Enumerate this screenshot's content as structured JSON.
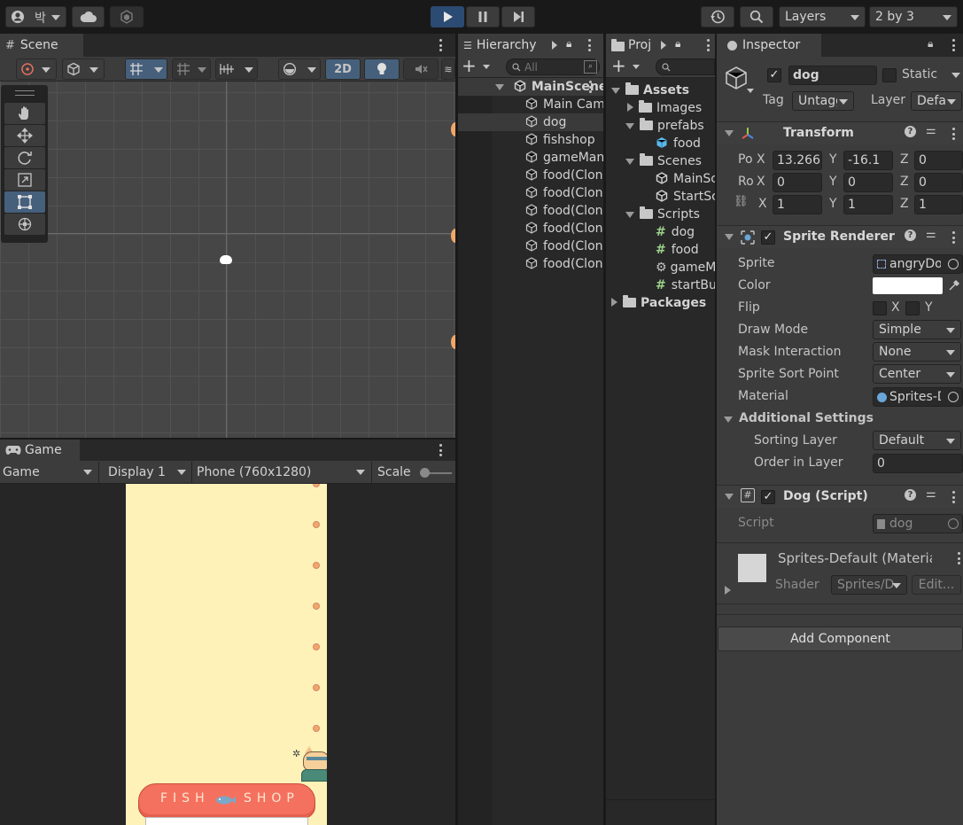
{
  "toolbar": {
    "account_label": "박",
    "layers_label": "Layers",
    "layout_label": "2 by 3"
  },
  "scene": {
    "tab_label": "Scene",
    "mode_2d_label": "2D"
  },
  "game": {
    "tab_label": "Game",
    "view_dropdown": "Game",
    "display_dropdown": "Display 1",
    "resolution_dropdown": "Phone (760x1280)",
    "scale_label": "Scale",
    "awning_text_left": "FISH",
    "awning_text_right": "SHOP"
  },
  "hierarchy": {
    "tab_label": "Hierarchy",
    "search_placeholder": "All",
    "root": "MainScene",
    "items": [
      "Main Camera",
      "dog",
      "fishshop",
      "gameManager",
      "food(Clone)",
      "food(Clone)",
      "food(Clone)",
      "food(Clone)",
      "food(Clone)",
      "food(Clone)"
    ]
  },
  "project": {
    "tab_label": "Project",
    "assets": "Assets",
    "images": "Images",
    "prefabs": "prefabs",
    "prefab_food": "food",
    "scenes": "Scenes",
    "scene_main": "MainScene",
    "scene_start": "StartScene",
    "scripts": "Scripts",
    "script_dog": "dog",
    "script_food": "food",
    "script_gm": "gameManager",
    "script_start": "startButton",
    "packages": "Packages"
  },
  "inspector": {
    "tab_label": "Inspector",
    "object_name": "dog",
    "static_label": "Static",
    "tag_label": "Tag",
    "tag_value": "Untagged",
    "layer_label": "Layer",
    "layer_value": "Default",
    "transform": {
      "title": "Transform",
      "pos_label": "Po",
      "rot_label": "Ro",
      "pos": {
        "x": "13.266",
        "y": "-16.1",
        "z": "0"
      },
      "rot": {
        "x": "0",
        "y": "0",
        "z": "0"
      },
      "scale": {
        "x": "1",
        "y": "1",
        "z": "1"
      },
      "x": "X",
      "y": "Y",
      "z": "Z"
    },
    "sprite_renderer": {
      "title": "Sprite Renderer",
      "sprite_label": "Sprite",
      "sprite_value": "angryDog",
      "color_label": "Color",
      "flip_label": "Flip",
      "flip_x": "X",
      "flip_y": "Y",
      "draw_mode_label": "Draw Mode",
      "draw_mode_value": "Simple",
      "mask_label": "Mask Interaction",
      "mask_value": "None",
      "sort_point_label": "Sprite Sort Point",
      "sort_point_value": "Center",
      "material_label": "Material",
      "material_value": "Sprites-Default",
      "additional_label": "Additional Settings",
      "sorting_layer_label": "Sorting Layer",
      "sorting_layer_value": "Default",
      "order_label": "Order in Layer",
      "order_value": "0"
    },
    "dog_script": {
      "title": "Dog (Script)",
      "script_label": "Script",
      "script_value": "dog"
    },
    "material": {
      "title": "Sprites-Default (Material)",
      "shader_label": "Shader",
      "shader_value": "Sprites/Default",
      "edit_label": "Edit..."
    },
    "add_component": "Add Component"
  },
  "colors": {
    "play_active": "#2c4b73",
    "selection": "#2c5d87",
    "game_bg": "#fff2b9",
    "awning": "#f5715f",
    "food_dot": "#f0a868"
  }
}
